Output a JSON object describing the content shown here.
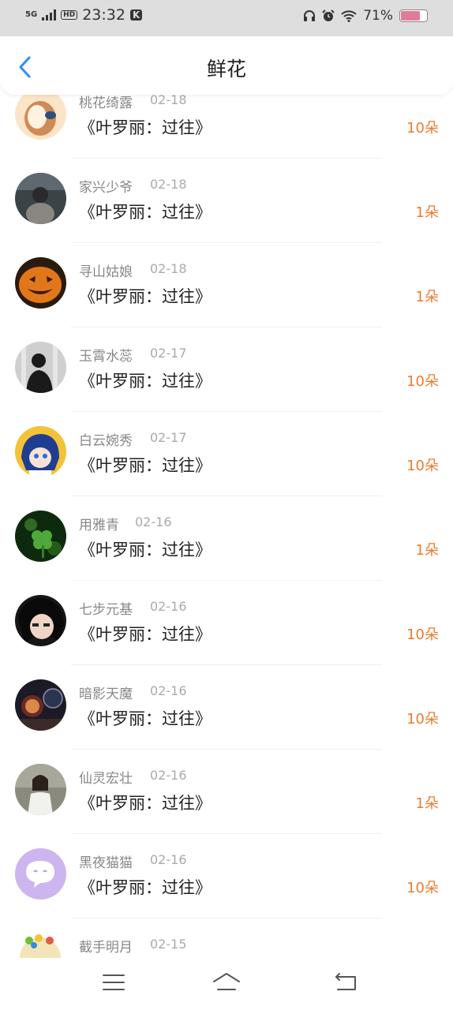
{
  "status_bar": {
    "network": "5G",
    "hd": "HD",
    "time": "23:32",
    "k_badge": "K",
    "battery": "71%",
    "battery_level": 0.71,
    "battery_color": "#e07b9a"
  },
  "header": {
    "title": "鲜花",
    "back_icon": "chevron-left-icon",
    "accent": "#2d8ff0"
  },
  "list": [
    {
      "name": "桃花绮露",
      "date": "02-18",
      "book": "《叶罗丽：过往》",
      "count": "10朵"
    },
    {
      "name": "家兴少爷",
      "date": "02-18",
      "book": "《叶罗丽：过往》",
      "count": "1朵"
    },
    {
      "name": "寻山姑娘",
      "date": "02-18",
      "book": "《叶罗丽：过往》",
      "count": "1朵"
    },
    {
      "name": "玉霄水蕊",
      "date": "02-17",
      "book": "《叶罗丽：过往》",
      "count": "10朵"
    },
    {
      "name": "白云婉秀",
      "date": "02-17",
      "book": "《叶罗丽：过往》",
      "count": "10朵"
    },
    {
      "name": "用雅青",
      "date": "02-16",
      "book": "《叶罗丽：过往》",
      "count": "1朵"
    },
    {
      "name": "七步元基",
      "date": "02-16",
      "book": "《叶罗丽：过往》",
      "count": "10朵"
    },
    {
      "name": "暗影天魔",
      "date": "02-16",
      "book": "《叶罗丽：过往》",
      "count": "10朵"
    },
    {
      "name": "仙灵宏壮",
      "date": "02-16",
      "book": "《叶罗丽：过往》",
      "count": "1朵"
    },
    {
      "name": "黑夜猫猫",
      "date": "02-16",
      "book": "《叶罗丽：过往》",
      "count": "10朵"
    },
    {
      "name": "截手明月",
      "date": "02-15"
    }
  ],
  "colors": {
    "count": "#ee7a2e",
    "name": "#888888",
    "date": "#aaaaaa"
  },
  "navigation_bar": {
    "menu_icon": "menu-icon",
    "home_icon": "home-icon",
    "back_icon": "back-icon"
  }
}
